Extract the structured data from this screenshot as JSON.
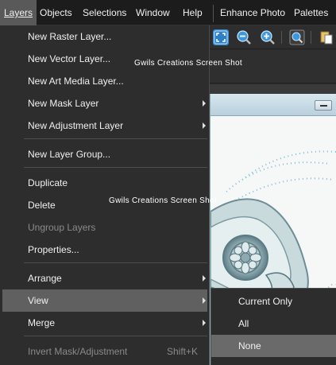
{
  "menubar": {
    "items": [
      "Layers",
      "Objects",
      "Selections",
      "Window",
      "Help",
      "Enhance Photo",
      "Palettes"
    ]
  },
  "layers_menu": {
    "items": [
      {
        "label": "New Raster Layer..."
      },
      {
        "label": "New Vector Layer..."
      },
      {
        "label": "New Art Media Layer..."
      },
      {
        "label": "New Mask Layer",
        "submenu": true
      },
      {
        "label": "New Adjustment Layer",
        "submenu": true
      },
      {
        "label": "New Layer Group..."
      },
      {
        "label": "Duplicate"
      },
      {
        "label": "Delete"
      },
      {
        "label": "Ungroup Layers",
        "disabled": true
      },
      {
        "label": "Properties..."
      },
      {
        "label": "Arrange",
        "submenu": true
      },
      {
        "label": "View",
        "submenu": true,
        "selected": true
      },
      {
        "label": "Merge",
        "submenu": true
      },
      {
        "label": "Invert Mask/Adjustment",
        "disabled": true,
        "shortcut": "Shift+K"
      }
    ]
  },
  "view_submenu": {
    "items": [
      {
        "label": "Current Only"
      },
      {
        "label": "All"
      },
      {
        "label": "None",
        "selected": true
      }
    ]
  },
  "watermarks": [
    "Gwils Creations Screen Shot",
    "Gwils Creations Screen Shot"
  ],
  "toolbar": {
    "icons": [
      "fit-window-icon",
      "zoom-out-icon",
      "zoom-in-icon",
      "zoom-actual-icon",
      "paste-icon"
    ]
  },
  "colors": {
    "menubar_bg": "#1c1c1c",
    "menu_bg": "#2d2d2d",
    "highlight": "#606060",
    "toolbar_accent": "#4aa3e0"
  }
}
